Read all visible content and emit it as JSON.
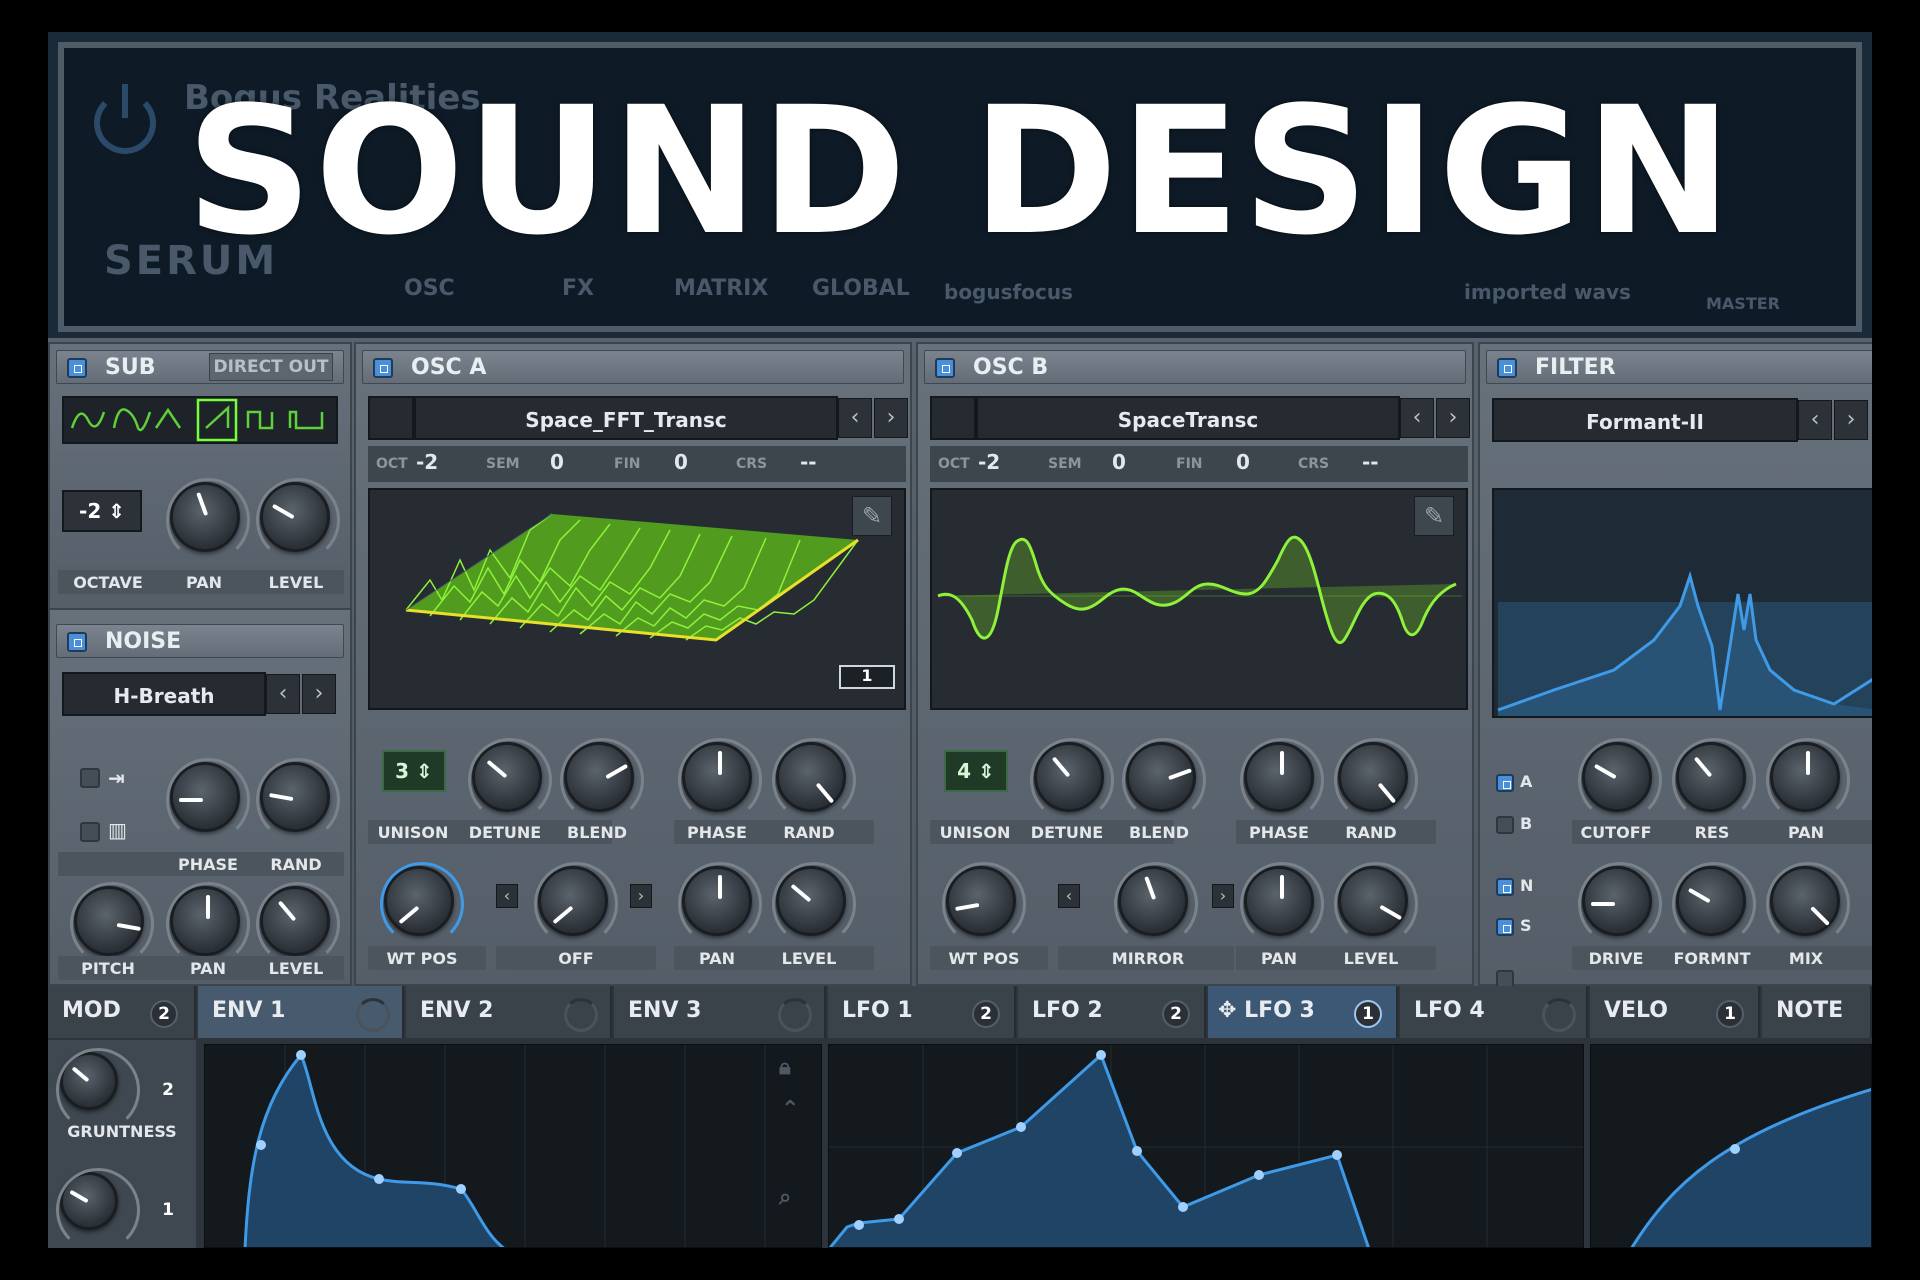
{
  "headline": "SOUND DESIGN",
  "top_bar": {
    "preset_name": "Bogus Realities",
    "logo": "SERUM",
    "nav_tabs": [
      "OSC",
      "FX",
      "MATRIX",
      "GLOBAL"
    ],
    "author": "bogusfocus",
    "folder": "imported wavs",
    "master_label": "MASTER"
  },
  "sub": {
    "title": "SUB",
    "direct_out": "DIRECT OUT",
    "octave_value": "-2",
    "knob_labels": [
      "OCTAVE",
      "PAN",
      "LEVEL"
    ],
    "waveforms": [
      "sine",
      "round",
      "triangle",
      "saw",
      "square",
      "pulse"
    ],
    "selected_wave_index": 3
  },
  "noise": {
    "title": "NOISE",
    "sample": "H-Breath",
    "knob_labels": [
      "PHASE",
      "RAND",
      "PITCH",
      "PAN",
      "LEVEL"
    ]
  },
  "osc_a": {
    "title": "OSC  A",
    "wavetable": "Space_FFT_Transc",
    "params": [
      {
        "label": "OCT",
        "value": "-2"
      },
      {
        "label": "SEM",
        "value": "0"
      },
      {
        "label": "FIN",
        "value": "0"
      },
      {
        "label": "CRS",
        "value": "--"
      }
    ],
    "frame_number": "1",
    "unison_value": "3",
    "knob_labels": [
      "UNISON",
      "DETUNE",
      "BLEND",
      "PHASE",
      "RAND",
      "WT POS",
      "OFF",
      "PAN",
      "LEVEL"
    ]
  },
  "osc_b": {
    "title": "OSC  B",
    "wavetable": "SpaceTransc",
    "params": [
      {
        "label": "OCT",
        "value": "-2"
      },
      {
        "label": "SEM",
        "value": "0"
      },
      {
        "label": "FIN",
        "value": "0"
      },
      {
        "label": "CRS",
        "value": "--"
      }
    ],
    "unison_value": "4",
    "knob_labels": [
      "UNISON",
      "DETUNE",
      "BLEND",
      "PHASE",
      "RAND",
      "WT POS",
      "MIRROR",
      "PAN",
      "LEVEL"
    ]
  },
  "filter": {
    "title": "FILTER",
    "type": "Formant-II",
    "routing": [
      "A",
      "B",
      "N",
      "S"
    ],
    "knob_labels": [
      "CUTOFF",
      "RES",
      "PAN",
      "DRIVE",
      "FORMNT",
      "MIX"
    ]
  },
  "mod": {
    "mod_label": "MOD",
    "mod_count": "2",
    "macro_label": "GRUNTNESS",
    "macro_count_1": "2",
    "macro_count_2": "1",
    "tabs": [
      {
        "label": "ENV 1",
        "badge": ""
      },
      {
        "label": "ENV 2",
        "badge": ""
      },
      {
        "label": "ENV 3",
        "badge": ""
      },
      {
        "label": "LFO 1",
        "badge": "2"
      },
      {
        "label": "LFO 2",
        "badge": "2"
      },
      {
        "label": "LFO 3",
        "badge": "1"
      },
      {
        "label": "LFO 4",
        "badge": ""
      },
      {
        "label": "VELO",
        "badge": "1"
      },
      {
        "label": "NOTE",
        "badge": ""
      }
    ]
  },
  "colors": {
    "accent_blue": "#3f9ae8",
    "wave_green": "#7ee02a",
    "panel": "#5e6872"
  }
}
